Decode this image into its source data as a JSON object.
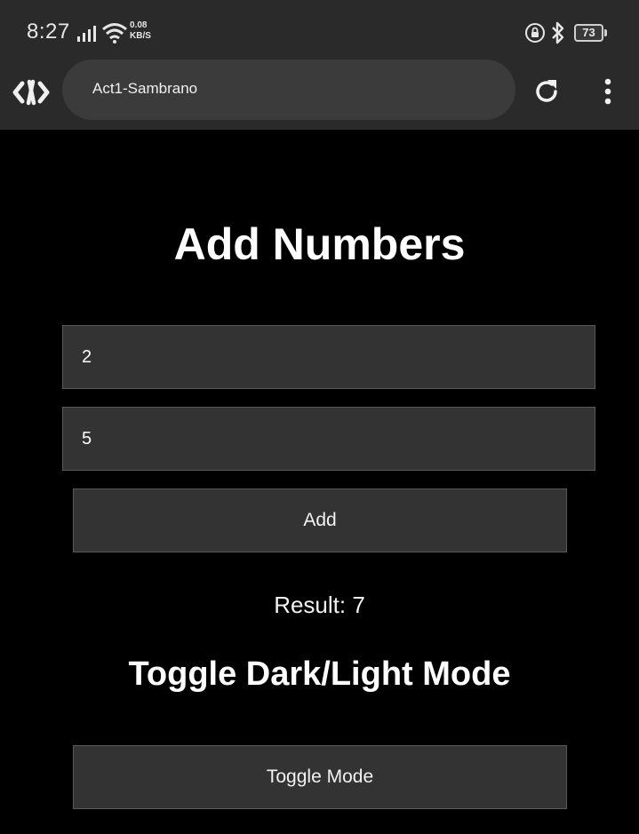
{
  "status_bar": {
    "time": "8:27",
    "net_speed_value": "0.08",
    "net_speed_unit": "KB/S",
    "battery_level": "73",
    "icons": [
      "signal-icon",
      "wifi-icon",
      "lock-icon",
      "bluetooth-icon",
      "battery-icon"
    ]
  },
  "browser": {
    "url_title": "Act1-Sambrano",
    "icons": [
      "app-logo-icon",
      "reload-icon",
      "more-menu-icon"
    ]
  },
  "page": {
    "title": "Add Numbers",
    "input_1_value": "2",
    "input_2_value": "5",
    "add_button_label": "Add",
    "result_text": "Result: 7",
    "toggle_section_title": "Toggle Dark/Light Mode",
    "toggle_button_label": "Toggle Mode"
  },
  "colors": {
    "page_background": "#000000",
    "chrome_background": "#2a2a2a",
    "control_background": "#333333",
    "text": "#ffffff"
  }
}
